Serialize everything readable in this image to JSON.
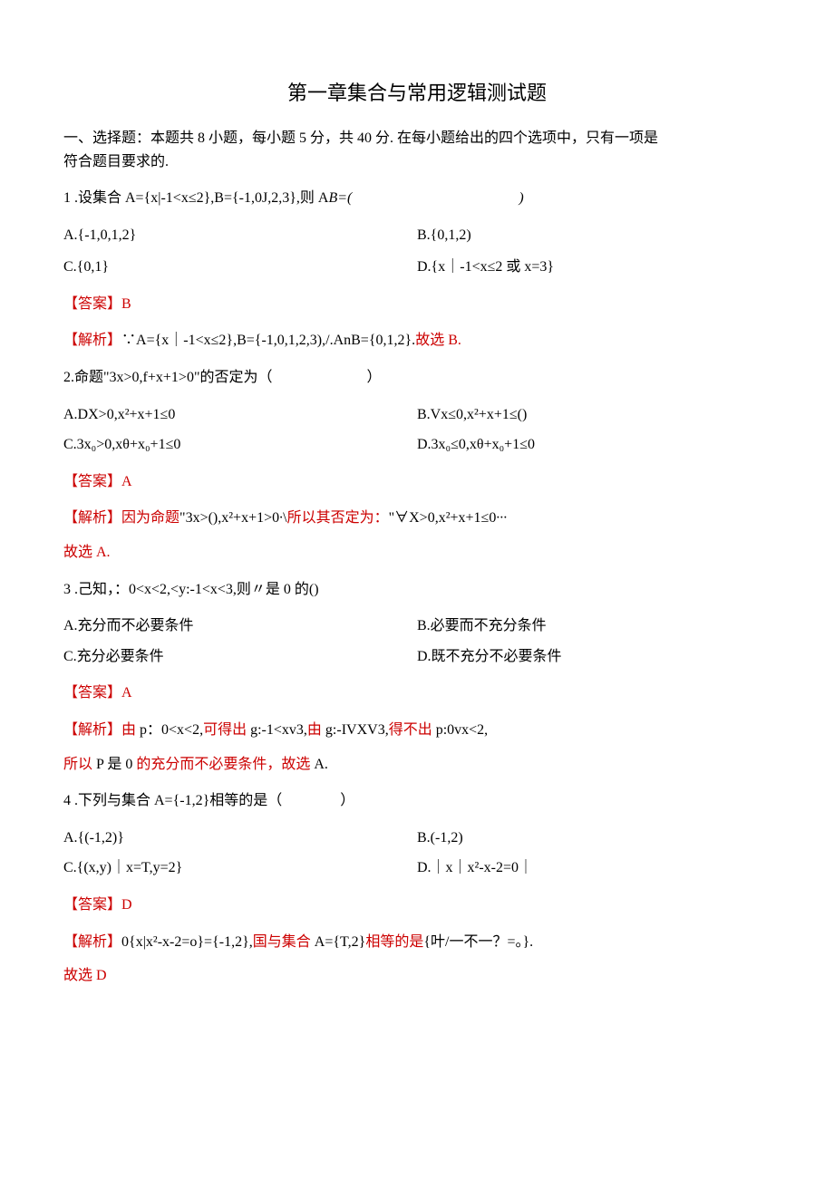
{
  "title": "第一章集合与常用逻辑测试题",
  "intro_line1": "一、选择题：本题共 8 小题，每小题 5 分，共 40 分. 在每小题给出的四个选项中，只有一项是",
  "intro_line2": "符合题目要求的.",
  "q1": {
    "stem": "1 .设集合 A={x|-1<x≤2},B={-1,0J,2,3},则 A",
    "stem_italic": "B=(",
    "stem_paren": ")",
    "optA": "A.{-1,0,1,2}",
    "optB": "B.{0,1,2)",
    "optC": "C.{0,1}",
    "optD": "D.{x｜-1<x≤2 或 x=3}",
    "answer_label": "【答案】",
    "answer_val": "B",
    "analysis_label": "【解析】",
    "analysis_black": "∵A={x｜-1<x≤2},B={-1,0,1,2,3),/.AnB={0,1,2}.",
    "analysis_red": "故选 B."
  },
  "q2": {
    "stem": "2.命题\"3x>0,f+x+1>0\"的否定为（",
    "stem_paren": "）",
    "optA": "A.DX>0,x²+x+1≤0",
    "optB": "B.Vx≤0,x²+x+1≤()",
    "optC": "C.3x₀>0,xθ+x₀+1≤0",
    "optD": "D.3x₀≤0,xθ+x₀+1≤0",
    "answer_label": "【答案】",
    "answer_val": "A",
    "analysis_label": "【解析】",
    "analysis_red1": "因为命题",
    "analysis_black1": "\"3x>(),x²+x+1>0∙\\",
    "analysis_red2": "所以其否定为：",
    "analysis_black2": "\"∀X>0,x²+x+1≤0∙∙∙",
    "analysis_line2": "故选 A."
  },
  "q3": {
    "stem": "3 .己知，：0<x<2,<y:-1<x<3,则〃是 0 的()",
    "optA": "A.充分而不必要条件",
    "optB": "B.必要而不充分条件",
    "optC": "C.充分必要条件",
    "optD": "D.既不充分不必要条件",
    "answer_label": "【答案】",
    "answer_val": "A",
    "analysis_label": "【解析】",
    "analysis_red1": "由",
    "analysis_black1": " p：0<x<2,",
    "analysis_red2": "可得出",
    "analysis_black2": " g:-1<xv3,",
    "analysis_red3": "由",
    "analysis_black3": " g:-IVXV3,",
    "analysis_red4": "得不出",
    "analysis_black4": " p:0vx<2,",
    "analysis_line2_red1": "所以",
    "analysis_line2_black": " P 是 0 ",
    "analysis_line2_red2": "的充分而不必要条件，故选",
    "analysis_line2_black2": " A."
  },
  "q4": {
    "stem": "4 .下列与集合 A={-1,2}相等的是（",
    "stem_paren": "）",
    "optA": "A.{(-1,2)}",
    "optB": "B.(-1,2)",
    "optC": "C.{(x,y)｜x=T,y=2}",
    "optD": "D.｜x｜x²-x-2=0｜",
    "answer_label": "【答案】",
    "answer_val": "D",
    "analysis_label": "【解析】",
    "analysis_black1": "0{x|x²-x-2=o}={-1,2},",
    "analysis_red1": "国与集合",
    "analysis_black2": " A={T,2}",
    "analysis_red2": "相等的是",
    "analysis_black3": "{叶/一不一？=。}.",
    "analysis_line2": "故选 D"
  }
}
